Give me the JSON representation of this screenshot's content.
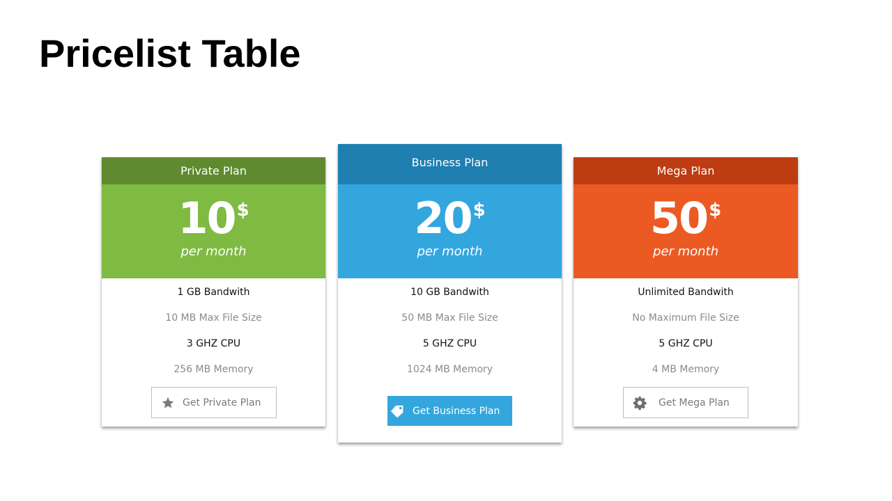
{
  "page": {
    "title": "Pricelist Table"
  },
  "plans": [
    {
      "name": "Private Plan",
      "price": "10",
      "currency": "$",
      "period": "per month",
      "features": [
        "1 GB Bandwith",
        "10 MB Max File Size",
        "3 GHZ CPU",
        "256 MB Memory"
      ],
      "button_label": "Get Private Plan",
      "button_icon": "star-icon",
      "colors": {
        "header": "#5F8A2F",
        "price_bg": "#7FBA42"
      }
    },
    {
      "name": "Business Plan",
      "price": "20",
      "currency": "$",
      "period": "per month",
      "features": [
        "10 GB Bandwith",
        "50 MB Max File Size",
        "5 GHZ CPU",
        "1024 MB Memory"
      ],
      "button_label": "Get Business Plan",
      "button_icon": "tag-icon",
      "colors": {
        "header": "#1E7FB0",
        "price_bg": "#33A6DE",
        "button": "#33A6DE"
      }
    },
    {
      "name": "Mega Plan",
      "price": "50",
      "currency": "$",
      "period": "per month",
      "features": [
        "Unlimited Bandwith",
        "No Maximum File Size",
        "5 GHZ CPU",
        "4 MB Memory"
      ],
      "button_label": "Get Mega Plan",
      "button_icon": "gear-icon",
      "colors": {
        "header": "#BE3C12",
        "price_bg": "#EC5A24"
      }
    }
  ]
}
